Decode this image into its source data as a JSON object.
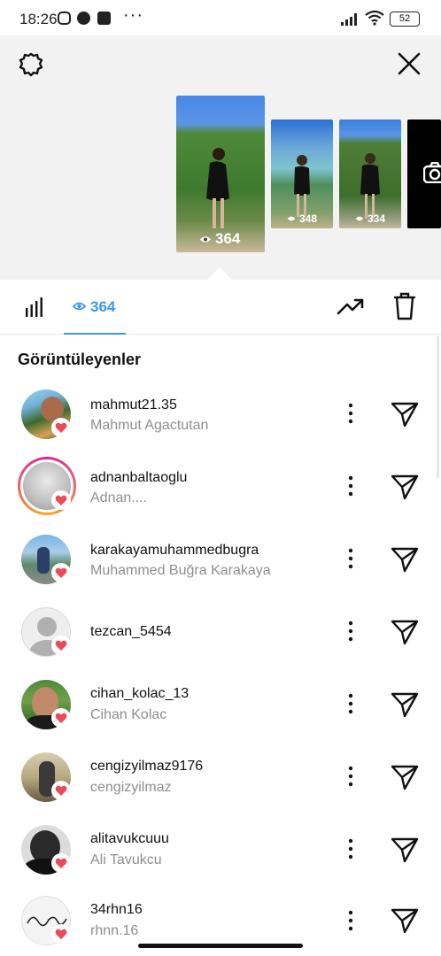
{
  "status_bar": {
    "time": "18:26",
    "battery": "52"
  },
  "story_thumbs": [
    {
      "views": "364"
    },
    {
      "views": "348"
    },
    {
      "views": "334"
    }
  ],
  "tabs": {
    "views_count": "364"
  },
  "section_title": "Görüntüleyenler",
  "viewers": [
    {
      "username": "mahmut21.35",
      "full_name": "Mahmut Agactutan"
    },
    {
      "username": "adnanbaltaoglu",
      "full_name": "Adnan...."
    },
    {
      "username": "karakayamuhammedbugra",
      "full_name": "Muhammed Buğra Karakaya"
    },
    {
      "username": "tezcan_5454",
      "full_name": ""
    },
    {
      "username": "cihan_kolac_13",
      "full_name": "Cihan Kolac"
    },
    {
      "username": "cengizyilmaz9176",
      "full_name": "cengizyilmaz"
    },
    {
      "username": "alitavukcuuu",
      "full_name": "Ali Tavukcu"
    },
    {
      "username": "34rhn16",
      "full_name": "rhnn.16"
    }
  ],
  "colors": {
    "accent": "#3897f0",
    "heart": "#ed4956",
    "story_ring_start": "#f9a825",
    "story_ring_end": "#d6249f"
  },
  "icons": [
    "settings-icon",
    "close-icon",
    "bar-chart-icon",
    "eye-icon",
    "trending-icon",
    "trash-icon",
    "more-icon",
    "send-icon",
    "heart-icon"
  ]
}
